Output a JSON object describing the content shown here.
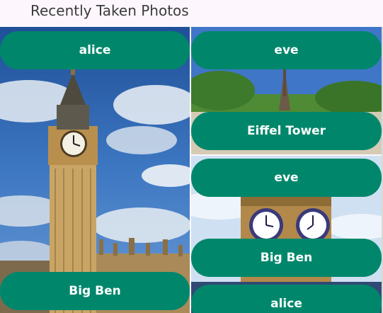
{
  "header": {
    "title": "Recently Taken Photos"
  },
  "photos": [
    {
      "user": "alice",
      "caption": "Big Ben",
      "image": "big-ben-tower-photo"
    },
    {
      "user": "eve",
      "caption": "Eiffel Tower",
      "image": "eiffel-tower-photo"
    },
    {
      "user": "eve",
      "caption": "Big Ben",
      "image": "big-ben-clock-photo"
    },
    {
      "user": "alice",
      "caption": "",
      "image": "partial-photo"
    }
  ],
  "colors": {
    "pill": "#00876b",
    "background": "#fdf7fd"
  }
}
